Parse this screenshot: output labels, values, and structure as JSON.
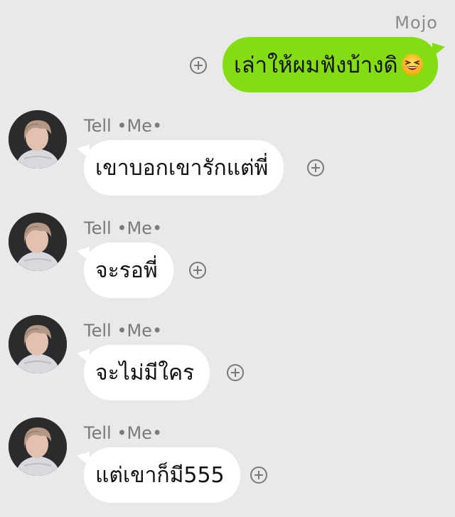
{
  "outgoing": {
    "sender": "Mojo",
    "text": "เล่าให้ผมฟังบ้างดิ",
    "emoji": "grinning-squinting-face"
  },
  "incoming": [
    {
      "name": "Tell •Me•",
      "text": "เขาบอกเขารักแต่พี่"
    },
    {
      "name": "Tell •Me•",
      "text": "จะรอพี่"
    },
    {
      "name": "Tell •Me•",
      "text": "จะไม่มีใคร"
    },
    {
      "name": "Tell •Me•",
      "text": "แต่เขาก็มี555"
    }
  ],
  "colors": {
    "background": "#e9e9ea",
    "outgoing_bubble": "#84dc13",
    "incoming_bubble": "#ffffff",
    "name_text": "#7a7a7a"
  }
}
